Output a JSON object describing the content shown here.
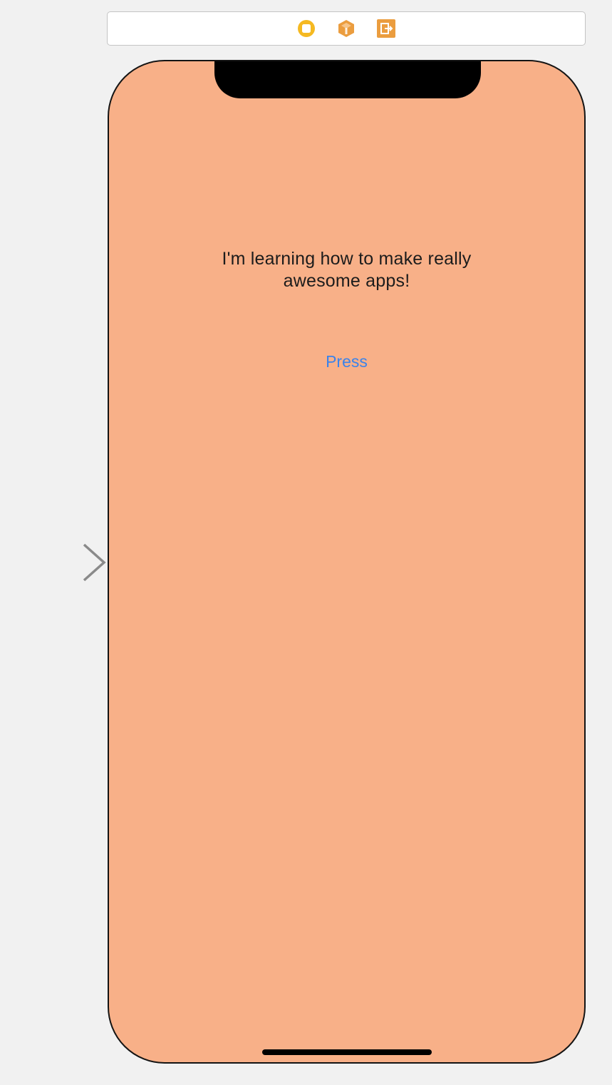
{
  "scene_dock": {
    "icons": [
      {
        "name": "view-controller-icon",
        "color": "#f5b921"
      },
      {
        "name": "first-responder-icon",
        "color": "#eb9d3f"
      },
      {
        "name": "exit-icon",
        "color": "#eb9d3f"
      }
    ]
  },
  "entry_point": {
    "icon": "storyboard-entry-arrow-icon",
    "color": "#8a8a8a"
  },
  "device": {
    "background_color": "#f8b088",
    "label": {
      "line1": "I'm learning how to make really",
      "line2": "awesome apps!"
    },
    "button": {
      "label": "Press",
      "color": "#3b83ea"
    }
  }
}
